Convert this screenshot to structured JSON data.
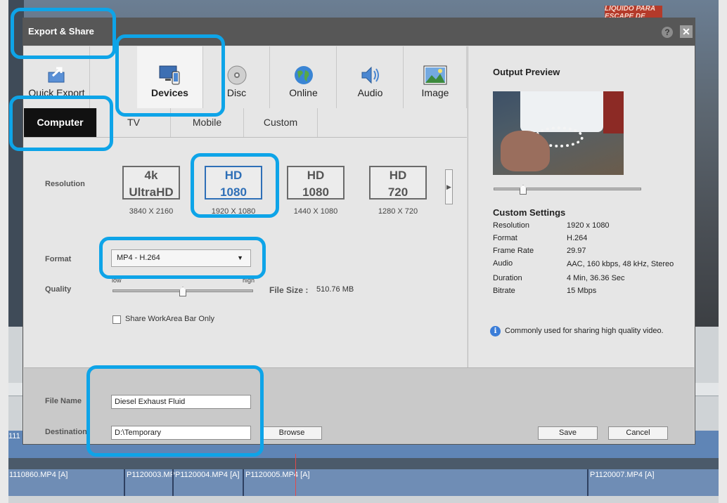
{
  "background": {
    "sign_text": "LIQUIDO PARA ESCAPE DE",
    "timeline_clips": [
      {
        "label": "1110860.MP4 [A]"
      },
      {
        "label": "P1120003.MP"
      },
      {
        "label": "P1120004.MP4 [A]"
      },
      {
        "label": "P1120005.MP4 [A]"
      },
      {
        "label": "P1120007.MP4 [A]"
      }
    ],
    "track_label": "111"
  },
  "dialog": {
    "title": "Export & Share",
    "help": "?",
    "close": "✕",
    "tabs": [
      {
        "id": "quick-export",
        "label": "Quick Export",
        "icon": "quick-export-icon"
      },
      {
        "id": "devices",
        "label": "Devices",
        "icon": "devices-icon",
        "selected": true
      },
      {
        "id": "disc",
        "label": "Disc",
        "icon": "disc-icon"
      },
      {
        "id": "online",
        "label": "Online",
        "icon": "globe-icon"
      },
      {
        "id": "audio",
        "label": "Audio",
        "icon": "speaker-icon"
      },
      {
        "id": "image",
        "label": "Image",
        "icon": "image-icon"
      }
    ],
    "subtabs": [
      {
        "label": "Computer",
        "selected": true
      },
      {
        "label": "TV"
      },
      {
        "label": "Mobile"
      },
      {
        "label": "Custom"
      }
    ],
    "resolution": {
      "label": "Resolution",
      "presets": [
        {
          "line1": "4k",
          "line2": "UltraHD",
          "sub": "3840 X 2160"
        },
        {
          "line1": "HD",
          "line2": "1080",
          "sub": "1920 X 1080",
          "selected": true
        },
        {
          "line1": "HD",
          "line2": "1080",
          "sub": "1440 X 1080"
        },
        {
          "line1": "HD",
          "line2": "720",
          "sub": "1280 X 720"
        }
      ],
      "next_arrow": "▶"
    },
    "format": {
      "label": "Format",
      "value": "MP4 - H.264",
      "caret": "▼"
    },
    "quality": {
      "label": "Quality",
      "low": "low",
      "high": "high",
      "level_fraction": 0.5
    },
    "file_size": {
      "label": "File Size :",
      "value": "510.76 MB"
    },
    "share_workarea": {
      "label": "Share WorkArea Bar Only",
      "checked": false
    },
    "file_name": {
      "label": "File Name",
      "value": "Diesel Exhaust Fluid"
    },
    "destination": {
      "label": "Destination",
      "value": "D:\\Temporary"
    },
    "browse_label": "Browse",
    "save_label": "Save",
    "cancel_label": "Cancel",
    "preview": {
      "title": "Output Preview",
      "scrub_fraction": 0.2
    },
    "custom_settings": {
      "title": "Custom Settings",
      "rows": [
        {
          "key": "Resolution",
          "value": "1920 x 1080"
        },
        {
          "key": "Format",
          "value": "H.264"
        },
        {
          "key": "Frame Rate",
          "value": "29.97"
        },
        {
          "key": "Audio",
          "value": "AAC, 160 kbps, 48 kHz, Stereo"
        },
        {
          "key": "Duration",
          "value": "4 Min, 36.36 Sec"
        },
        {
          "key": "Bitrate",
          "value": "15 Mbps"
        }
      ]
    },
    "info": {
      "icon": "i",
      "text": "Commonly used for sharing high quality video."
    }
  },
  "colors": {
    "highlight": "#0ea4e8",
    "selected_preset": "#2e6fb7",
    "subtab_selected_bg": "#111111"
  }
}
